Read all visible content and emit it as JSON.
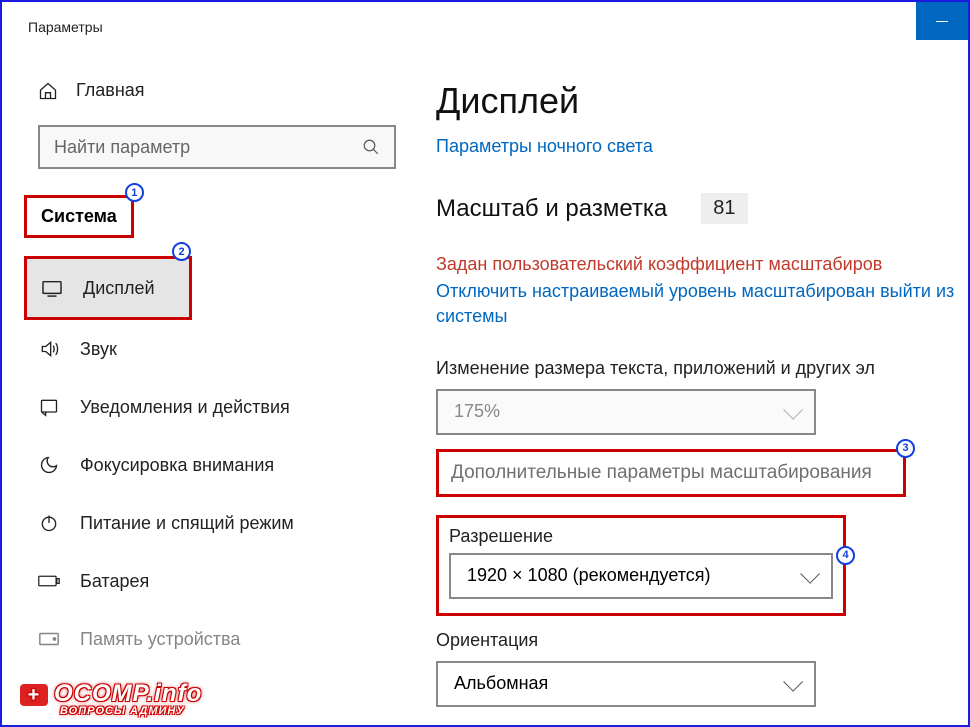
{
  "window": {
    "title": "Параметры"
  },
  "sidebar": {
    "home": "Главная",
    "search_placeholder": "Найти параметр",
    "section": "Система",
    "items": [
      {
        "label": "Дисплей"
      },
      {
        "label": "Звук"
      },
      {
        "label": "Уведомления и действия"
      },
      {
        "label": "Фокусировка внимания"
      },
      {
        "label": "Питание и спящий режим"
      },
      {
        "label": "Батарея"
      },
      {
        "label": "Память устройства"
      }
    ]
  },
  "main": {
    "title": "Дисплей",
    "night_link": "Параметры ночного света",
    "scale_heading": "Масштаб и разметка",
    "scale_value": "81",
    "warning": "Задан пользовательский коэффициент масштабиров",
    "disable_link": "Отключить настраиваемый уровень масштабирован выйти из системы",
    "size_label": "Изменение размера текста, приложений и других эл",
    "size_select": "175%",
    "advanced": "Дополнительные параметры масштабирования",
    "resolution_label": "Разрешение",
    "resolution_value": "1920 × 1080 (рекомендуется)",
    "orientation_label": "Ориентация",
    "orientation_value": "Альбомная"
  },
  "badges": {
    "b1": "1",
    "b2": "2",
    "b3": "3",
    "b4": "4"
  },
  "watermark": {
    "line1": "OCOMP.info",
    "line2": "ВОПРОСЫ АДМИНУ"
  }
}
